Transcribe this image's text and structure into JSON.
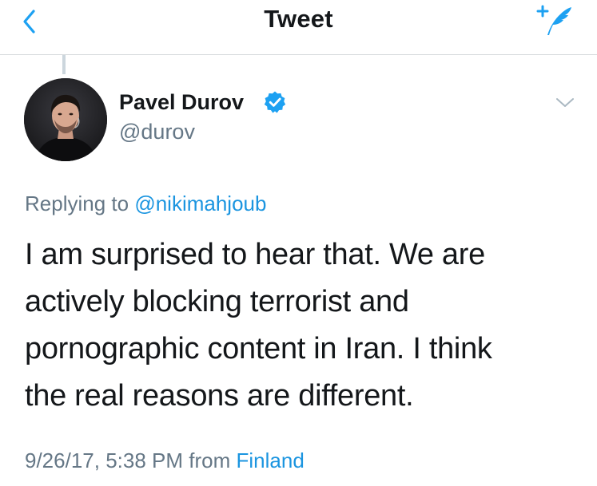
{
  "header": {
    "title": "Tweet",
    "back_icon": "chevron-left-icon",
    "compose_icon": "compose-tweet-icon",
    "accent_color": "#1da1f2"
  },
  "tweet": {
    "author": {
      "name": "Pavel Durov",
      "handle": "@durov",
      "verified": true,
      "verified_icon": "verified-badge-icon"
    },
    "replying_prefix": "Replying to",
    "replying_to": "@nikimahjoub",
    "text_lines": [
      "I am surprised to hear that. We are",
      "actively blocking terrorist and",
      "pornographic content in Iran. I think",
      "the real reasons are different."
    ],
    "timestamp": "9/26/17, 5:38 PM",
    "from_label": "from",
    "location": "Finland",
    "more_icon": "chevron-down-icon"
  },
  "colors": {
    "text": "#14171a",
    "secondary": "#657786",
    "link": "#1b95e0",
    "divider": "#d6d9dc"
  }
}
